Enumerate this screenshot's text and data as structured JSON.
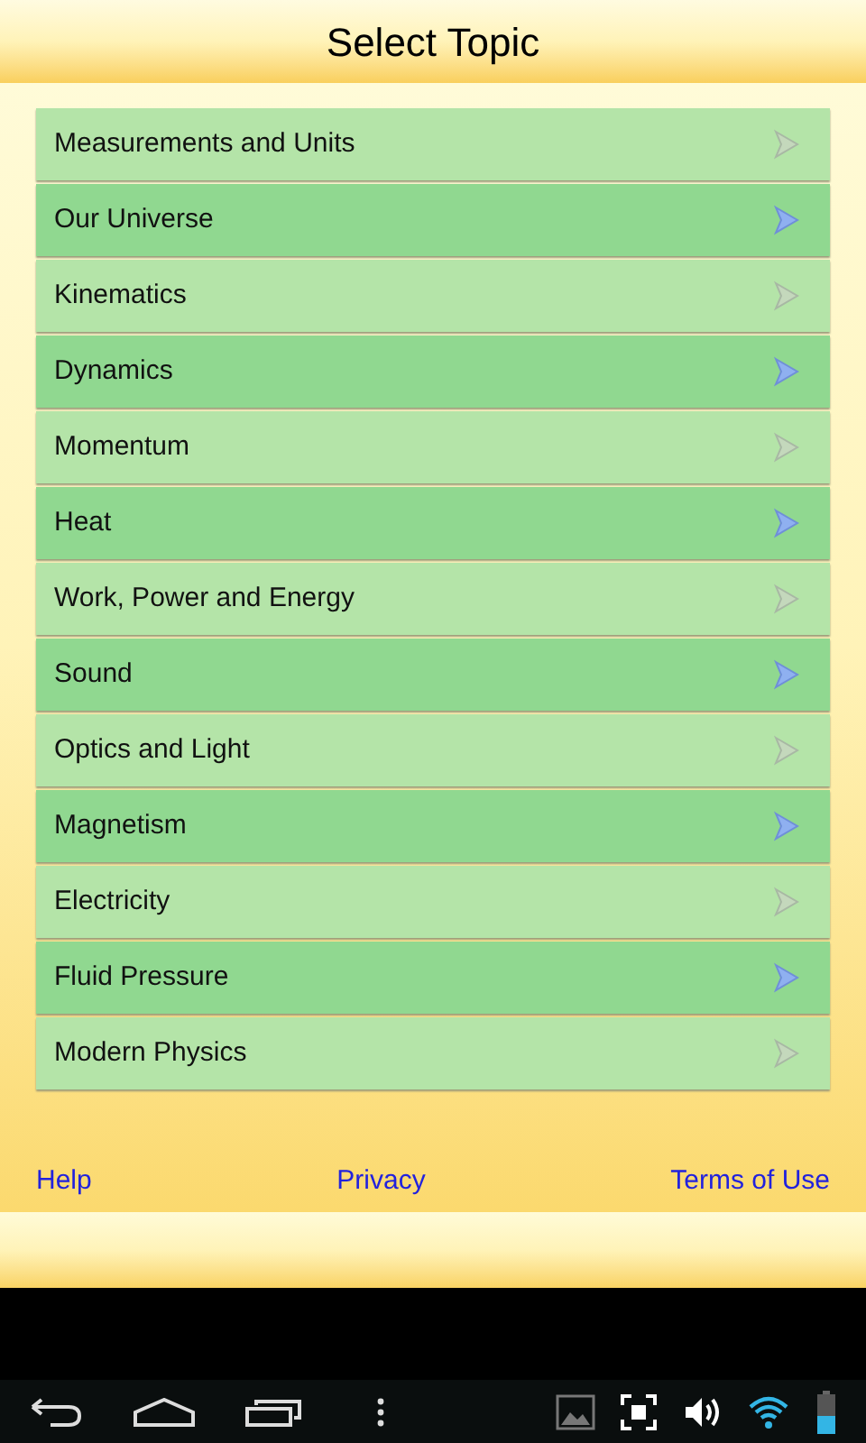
{
  "header": {
    "title": "Select Topic"
  },
  "topics": [
    "Measurements and Units",
    "Our Universe",
    "Kinematics",
    "Dynamics",
    "Momentum",
    "Heat",
    "Work, Power and Energy",
    "Sound",
    "Optics and Light",
    "Magnetism",
    "Electricity",
    "Fluid Pressure",
    "Modern Physics"
  ],
  "footer_links": [
    "Help",
    "Privacy",
    "Terms of Use"
  ]
}
